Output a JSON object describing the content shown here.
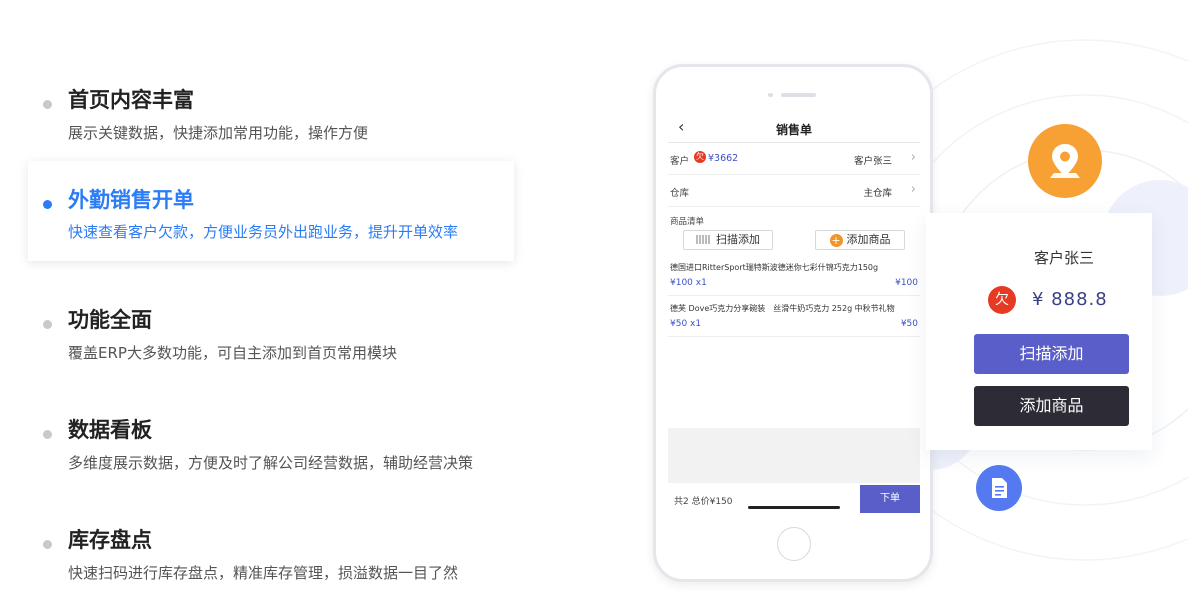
{
  "features": [
    {
      "title": "首页内容丰富",
      "desc": "展示关键数据，快捷添加常用功能，操作方便",
      "active": false
    },
    {
      "title": "外勤销售开单",
      "desc": "快速查看客户欠款，方便业务员外出跑业务，提升开单效率",
      "active": true
    },
    {
      "title": "功能全面",
      "desc": "覆盖ERP大多数功能，可自主添加到首页常用模块",
      "active": false
    },
    {
      "title": "数据看板",
      "desc": "多维度展示数据，方便及时了解公司经营数据，辅助经营决策",
      "active": false
    },
    {
      "title": "库存盘点",
      "desc": "快速扫码进行库存盘点，精准库存管理，损溢数据一目了然",
      "active": false
    }
  ],
  "phone": {
    "nav_title": "销售单",
    "customer_label": "客户",
    "owe_badge": "欠",
    "debt": "¥3662",
    "customer_name": "客户张三",
    "warehouse_label": "仓库",
    "warehouse_value": "主仓库",
    "list_label": "商品清单",
    "scan_button": "扫描添加",
    "add_button": "添加商品",
    "items": [
      {
        "name": "德国进口RitterSport瑞特斯波德迷你七彩什锦巧克力150g",
        "price_qty": "¥100 x1",
        "amount": "¥100"
      },
      {
        "name": "德芙 Dove巧克力分享碗装　丝滑牛奶巧克力 252g 中秋节礼物",
        "price_qty": "¥50 x1",
        "amount": "¥50"
      }
    ],
    "total_text": "共2  总价¥150",
    "submit_button": "下单"
  },
  "card": {
    "customer_name": "客户张三",
    "owe_badge": "欠",
    "amount": "¥ 888.8",
    "scan_button": "扫描添加",
    "add_button": "添加商品"
  },
  "colors": {
    "accent_blue": "#2b7cf6",
    "purple": "#5a5ec9",
    "dark": "#2d2c36",
    "owe_red": "#e73a24",
    "orange": "#f7a134",
    "doc_blue": "#5479f0"
  },
  "icons": {
    "location": "location-pin-icon",
    "document": "document-icon",
    "back": "chevron-left-icon",
    "barcode": "barcode-icon",
    "plus": "plus-circle-icon"
  }
}
